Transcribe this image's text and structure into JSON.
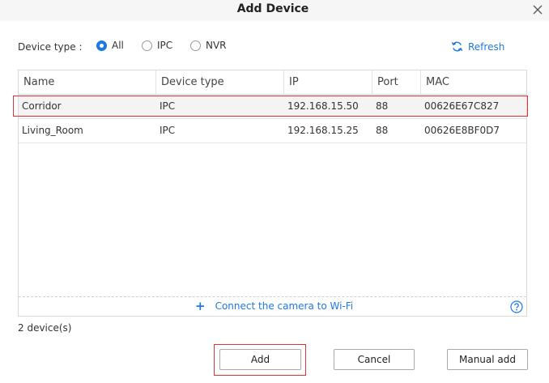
{
  "dialog": {
    "title": "Add Device"
  },
  "filter": {
    "label": "Device type :",
    "options": [
      {
        "label": "All",
        "checked": true
      },
      {
        "label": "IPC",
        "checked": false
      },
      {
        "label": "NVR",
        "checked": false
      }
    ],
    "refresh_label": "Refresh"
  },
  "table": {
    "columns": [
      "Name",
      "Device type",
      "IP",
      "Port",
      "MAC"
    ],
    "rows": [
      {
        "name": "Corridor",
        "type": "IPC",
        "ip": "192.168.15.50",
        "port": "88",
        "mac": "00626E67C827",
        "selected": true
      },
      {
        "name": "Living_Room",
        "type": "IPC",
        "ip": "192.168.15.25",
        "port": "88",
        "mac": "00626E8BF0D7",
        "selected": false
      }
    ]
  },
  "wifi": {
    "plus": "+",
    "label": "Connect the camera to Wi-Fi"
  },
  "status": {
    "count_text": "2 device(s)"
  },
  "buttons": {
    "add": "Add",
    "cancel": "Cancel",
    "manual_add": "Manual add"
  },
  "colors": {
    "accent": "#1e7ae0",
    "highlight": "#d9343a"
  }
}
